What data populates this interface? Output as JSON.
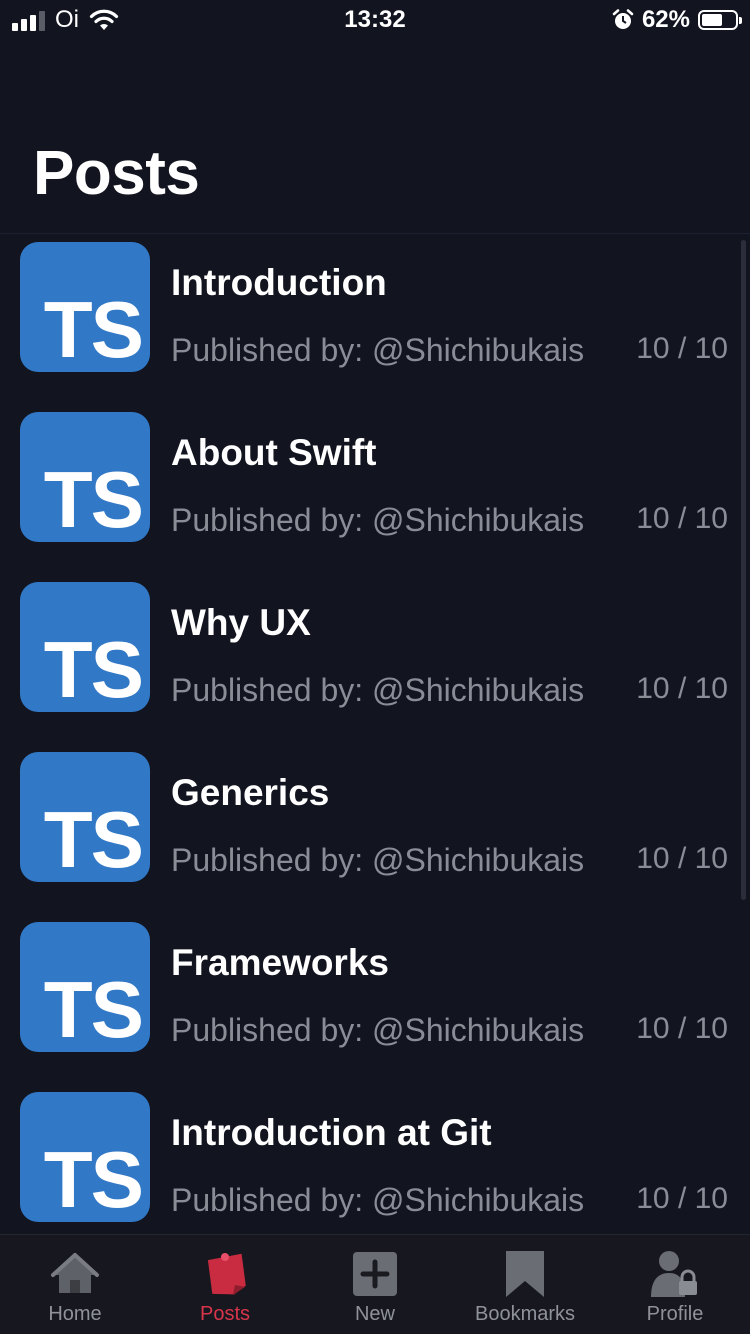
{
  "status_bar": {
    "carrier": "Oi",
    "time": "13:32",
    "battery": "62%",
    "battery_level": 0.62
  },
  "header": {
    "title": "Posts"
  },
  "posts": [
    {
      "title": "Introduction",
      "author": "Published by: @Shichibukais",
      "score": "10 / 10",
      "thumb": "TS"
    },
    {
      "title": "About Swift",
      "author": "Published by: @Shichibukais",
      "score": "10 / 10",
      "thumb": "TS"
    },
    {
      "title": "Why UX",
      "author": "Published by: @Shichibukais",
      "score": "10 / 10",
      "thumb": "TS"
    },
    {
      "title": "Generics",
      "author": "Published by: @Shichibukais",
      "score": "10 / 10",
      "thumb": "TS"
    },
    {
      "title": "Frameworks",
      "author": "Published by: @Shichibukais",
      "score": "10 / 10",
      "thumb": "TS"
    },
    {
      "title": "Introduction at Git",
      "author": "Published by: @Shichibukais",
      "score": "10 / 10",
      "thumb": "TS"
    }
  ],
  "tab_bar": {
    "tabs": [
      {
        "label": "Home",
        "icon": "home-icon"
      },
      {
        "label": "Posts",
        "icon": "posts-icon",
        "active": true
      },
      {
        "label": "New",
        "icon": "new-icon"
      },
      {
        "label": "Bookmarks",
        "icon": "bookmark-icon"
      },
      {
        "label": "Profile",
        "icon": "profile-icon"
      }
    ]
  },
  "colors": {
    "background": "#121420",
    "thumb": "#3178c6",
    "active_tab": "#d8344b",
    "muted_text": "#8a8d96"
  }
}
